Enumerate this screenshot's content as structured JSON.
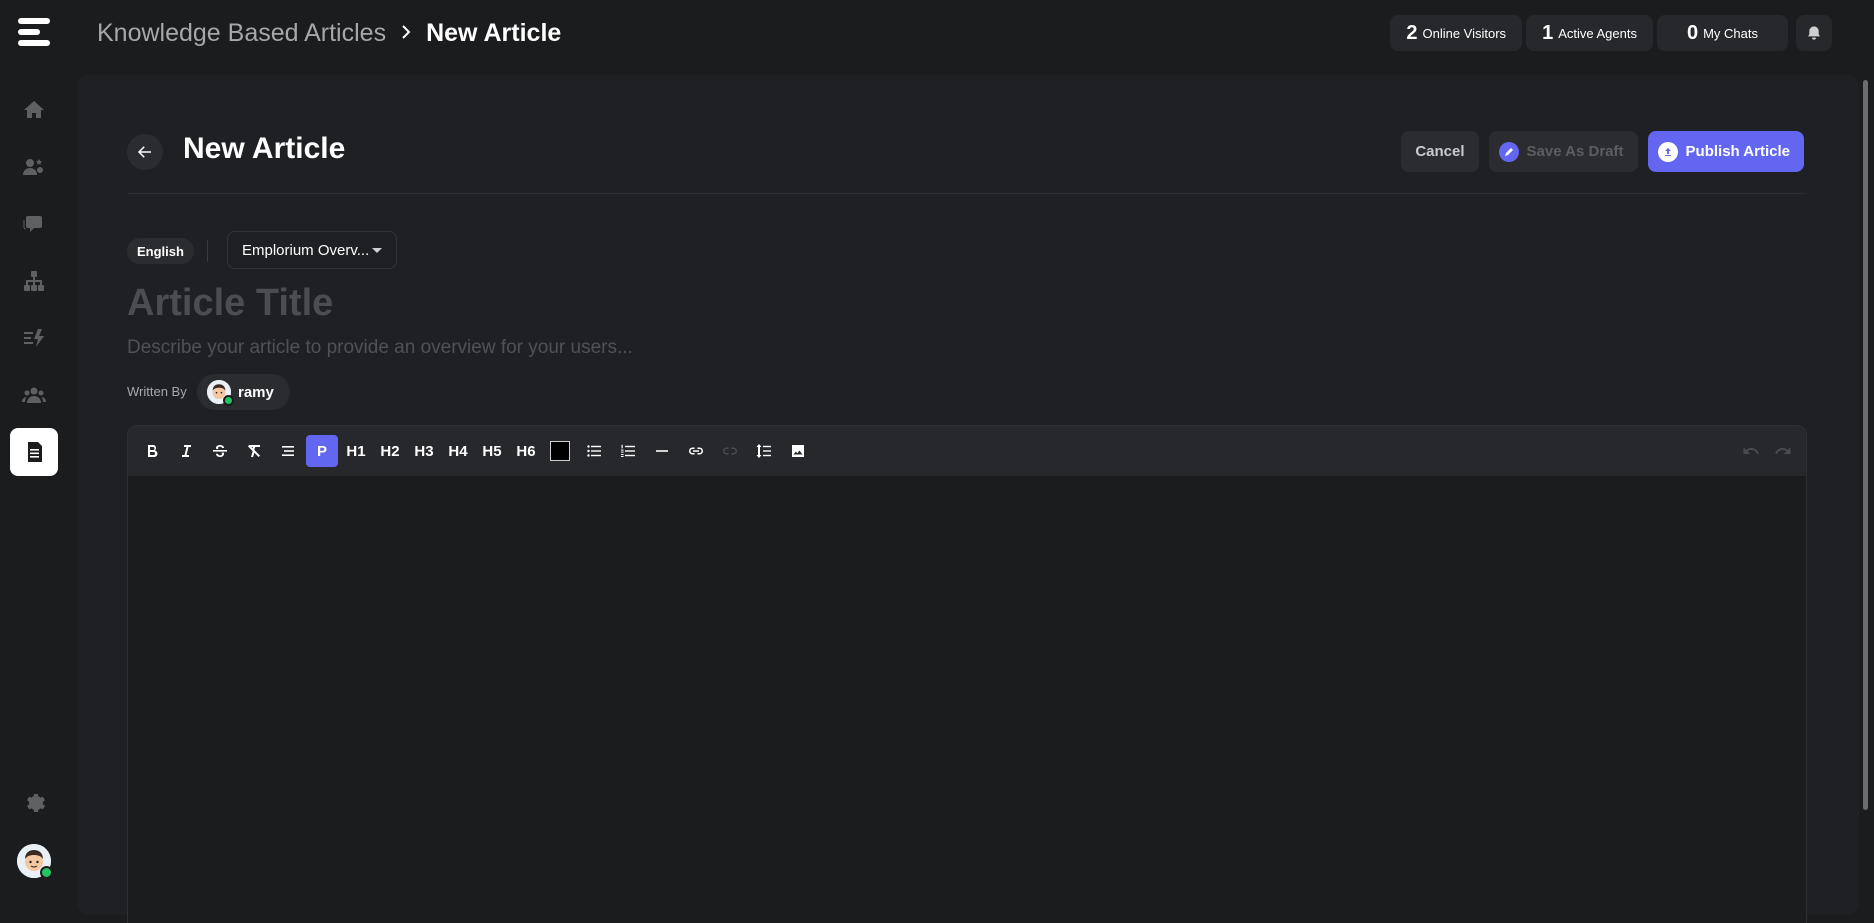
{
  "header": {
    "breadcrumb_parent": "Knowledge Based Articles",
    "breadcrumb_current": "New Article",
    "stats": [
      {
        "count": "2",
        "label": "Online Visitors"
      },
      {
        "count": "1",
        "label": "Active Agents"
      },
      {
        "count": "0",
        "label": "My Chats"
      }
    ]
  },
  "page": {
    "title": "New Article",
    "cancel_label": "Cancel",
    "draft_label": "Save As Draft",
    "publish_label": "Publish Article"
  },
  "form": {
    "language": "English",
    "category": "Emplorium Overv...",
    "title_placeholder": "Article Title",
    "description_placeholder": "Describe your article to provide an overview for your users...",
    "written_by_label": "Written By",
    "author": "ramy"
  },
  "toolbar": {
    "paragraph": "P",
    "h1": "H1",
    "h2": "H2",
    "h3": "H3",
    "h4": "H4",
    "h5": "H5",
    "h6": "H6"
  },
  "colors": {
    "accent": "#6366f1",
    "background": "#1b1c1e",
    "panel": "#1f2023",
    "online": "#22c55e"
  },
  "sidebar_icons": [
    "home-icon",
    "contacts-icon",
    "chats-icon",
    "org-chart-icon",
    "automation-icon",
    "team-icon",
    "articles-icon",
    "settings-icon"
  ]
}
